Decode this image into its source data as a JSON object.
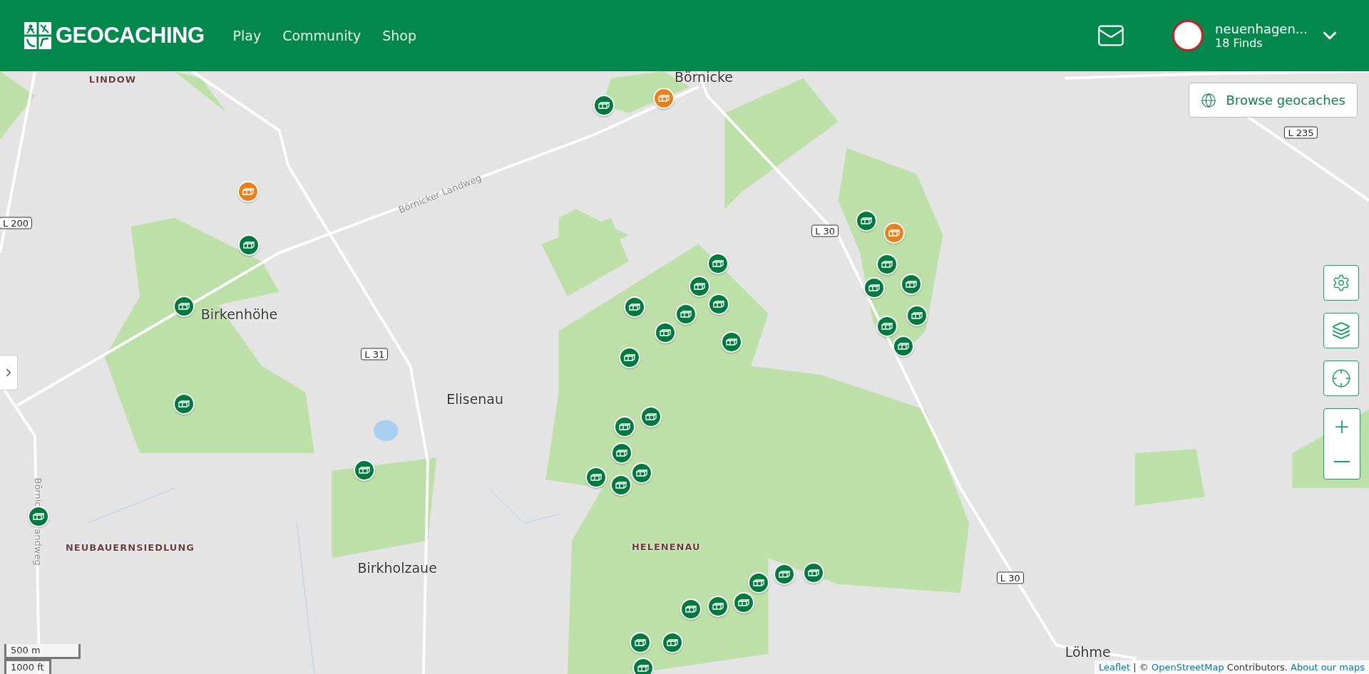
{
  "header": {
    "logo": "GEOCACHING",
    "nav": [
      {
        "label": "Play"
      },
      {
        "label": "Community"
      },
      {
        "label": "Shop"
      }
    ],
    "user": {
      "name": "neuenhagen...",
      "finds": "18 Finds"
    }
  },
  "browse_button": "Browse geocaches",
  "map_labels": [
    {
      "kind": "district",
      "text": "LINDOW"
    },
    {
      "kind": "town",
      "text": "Börnicke"
    },
    {
      "kind": "road",
      "text": "Börnicker Landweg"
    },
    {
      "kind": "town",
      "text": "Birkenhöhe"
    },
    {
      "kind": "town",
      "text": "Elisenau"
    },
    {
      "kind": "town",
      "text": "Birkholzaue"
    },
    {
      "kind": "district",
      "text": "HELENENAU"
    },
    {
      "kind": "district",
      "text": "NEUBAUERNSIEDLUNG"
    },
    {
      "kind": "town",
      "text": "Löhme"
    },
    {
      "kind": "road-vertical",
      "text": "Börnic"
    },
    {
      "kind": "road-vertical",
      "text": "andweg"
    },
    {
      "kind": "shield",
      "text": "L 200"
    },
    {
      "kind": "shield",
      "text": "L 31"
    },
    {
      "kind": "shield",
      "text": "L 30"
    },
    {
      "kind": "shield",
      "text": "L 235"
    },
    {
      "kind": "shield",
      "text": "L 30"
    }
  ],
  "markers": [
    {
      "color": "#e3821e"
    },
    {
      "color": "#e3821e"
    },
    {
      "color": "#e3821e"
    },
    {
      "color": "#027a3f"
    },
    {
      "color": "#027a3f"
    },
    {
      "color": "#027a3f"
    },
    {
      "color": "#027a3f"
    },
    {
      "color": "#027a3f"
    },
    {
      "color": "#027a3f"
    },
    {
      "color": "#027a3f"
    },
    {
      "color": "#027a3f"
    },
    {
      "color": "#027a3f"
    },
    {
      "color": "#027a3f"
    },
    {
      "color": "#027a3f"
    },
    {
      "color": "#027a3f"
    },
    {
      "color": "#027a3f"
    },
    {
      "color": "#027a3f"
    },
    {
      "color": "#027a3f"
    },
    {
      "color": "#027a3f"
    },
    {
      "color": "#027a3f"
    },
    {
      "color": "#027a3f"
    },
    {
      "color": "#027a3f"
    },
    {
      "color": "#027a3f"
    },
    {
      "color": "#027a3f"
    },
    {
      "color": "#027a3f"
    },
    {
      "color": "#027a3f"
    },
    {
      "color": "#027a3f"
    },
    {
      "color": "#027a3f"
    },
    {
      "color": "#027a3f"
    },
    {
      "color": "#027a3f"
    },
    {
      "color": "#027a3f"
    },
    {
      "color": "#027a3f"
    },
    {
      "color": "#027a3f"
    },
    {
      "color": "#027a3f"
    },
    {
      "color": "#027a3f"
    },
    {
      "color": "#027a3f"
    },
    {
      "color": "#027a3f"
    },
    {
      "color": "#027a3f"
    },
    {
      "color": "#027a3f"
    }
  ],
  "scale": {
    "metric": "500 m",
    "imperial": "1000 ft"
  },
  "attribution": {
    "leaflet": "Leaflet",
    "separator": "| ©",
    "osm": "OpenStreetMap",
    "text": "Contributors.",
    "about": "About our maps"
  }
}
